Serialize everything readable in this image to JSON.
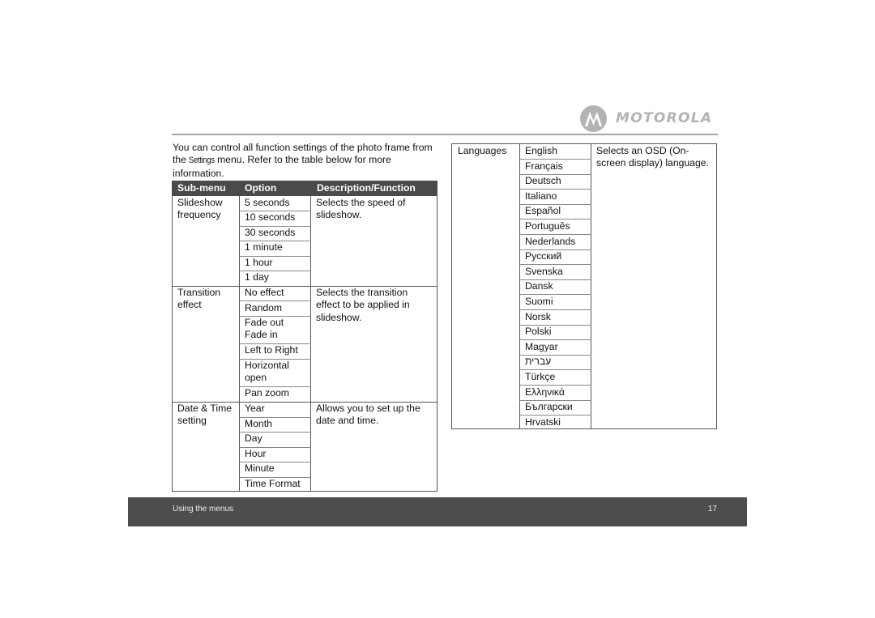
{
  "brand": {
    "name": "MOTOROLA",
    "logo_icon": "motorola-batwing-logo"
  },
  "intro": {
    "part1": "You can control all function settings of the photo frame from the ",
    "menu_word": "Settings",
    "part2": " menu. Refer to the table below for more information."
  },
  "settings_table": {
    "headers": [
      "Sub-menu",
      "Option",
      "Description/Function"
    ],
    "sections": [
      {
        "submenu": "Slideshow frequency",
        "options": [
          "5 seconds",
          "10 seconds",
          "30 seconds",
          "1 minute",
          "1 hour",
          "1 day"
        ],
        "description": "Selects the speed of slideshow."
      },
      {
        "submenu": "Transition effect",
        "options": [
          "No effect",
          "Random",
          "Fade out Fade in",
          "Left to Right",
          "Horizontal open",
          "Pan zoom"
        ],
        "description": "Selects the transition effect to be applied in slideshow."
      },
      {
        "submenu": "Date & Time setting",
        "options": [
          "Year",
          "Month",
          "Day",
          "Hour",
          "Minute",
          "Time Format"
        ],
        "description": "Allows you to set up the date and time."
      }
    ]
  },
  "languages_table": {
    "submenu": "Languages",
    "options": [
      "English",
      "Français",
      "Deutsch",
      "Italiano",
      "Español",
      "Português",
      "Nederlands",
      "Русский",
      "Svenska",
      "Dansk",
      "Suomi",
      "Norsk",
      "Polski",
      "Magyar",
      "עברית",
      "Türkçe",
      "Ελληνικά",
      "Български",
      "Hrvatski"
    ],
    "description": "Selects an OSD (On-screen display) language."
  },
  "footer": {
    "section": "Using the menus",
    "page_number": "17"
  }
}
